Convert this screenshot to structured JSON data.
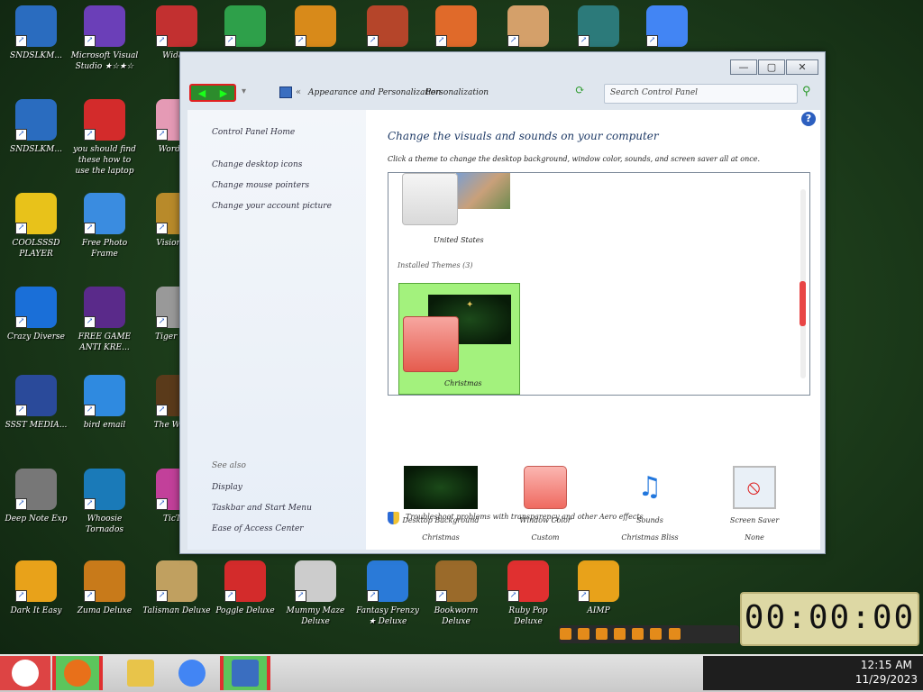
{
  "desktop_icons": [
    {
      "label": "SNDSLKM...",
      "color": "#2a6cbf"
    },
    {
      "label": "Microsoft Visual Studio ★☆★☆",
      "color": "#6b3fb8"
    },
    {
      "label": "Wida...",
      "color": "#c23030"
    },
    {
      "label": "",
      "color": "#2ea04a"
    },
    {
      "label": "",
      "color": "#d88a1a"
    },
    {
      "label": "",
      "color": "#b5452a"
    },
    {
      "label": "",
      "color": "#e06a2a"
    },
    {
      "label": "",
      "color": "#d4a06a"
    },
    {
      "label": "",
      "color": "#2c7a7a"
    },
    {
      "label": "",
      "color": "#4285f4"
    },
    {
      "label": "SNDSLKM...",
      "color": "#2a6cbf"
    },
    {
      "label": "you should find these how to use the laptop",
      "color": "#d32b2b"
    },
    {
      "label": "Word F...",
      "color": "#e59ab5"
    },
    {
      "label": "COOLSSSD PLAYER",
      "color": "#e8c21a"
    },
    {
      "label": "Free Photo Frame",
      "color": "#3a8ce0"
    },
    {
      "label": "Vision S...",
      "color": "#b88a2a"
    },
    {
      "label": "Crazy Diverse",
      "color": "#1a6fd8"
    },
    {
      "label": "FREE GAME ANTI KRE...",
      "color": "#5a2a8a"
    },
    {
      "label": "Tiger Sh...",
      "color": "#999999"
    },
    {
      "label": "SSST MEDIA...",
      "color": "#2a4a9a"
    },
    {
      "label": "bird email",
      "color": "#2f8ae0"
    },
    {
      "label": "The Wiza...",
      "color": "#5a3a1a"
    },
    {
      "label": "Deep Note Exp",
      "color": "#777777"
    },
    {
      "label": "Whoosie Tornados",
      "color": "#1a7ab8"
    },
    {
      "label": "TicToe",
      "color": "#c2409a"
    },
    {
      "label": "Dark It Easy",
      "color": "#e8a21a"
    },
    {
      "label": "Zuma Deluxe",
      "color": "#c87a1a"
    },
    {
      "label": "Talisman Deluxe",
      "color": "#c0a060"
    },
    {
      "label": "Poggle Deluxe",
      "color": "#d32b2b"
    },
    {
      "label": "Mummy Maze Deluxe",
      "color": "#cccccc"
    },
    {
      "label": "Fantasy Frenzy ★ Deluxe",
      "color": "#2a7ad8"
    },
    {
      "label": "Bookworm Deluxe",
      "color": "#9a6a2a"
    },
    {
      "label": "Ruby Pop Deluxe",
      "color": "#e03030"
    },
    {
      "label": "AIMP",
      "color": "#e8a21a"
    }
  ],
  "window": {
    "minimize": "—",
    "maximize": "▢",
    "close": "✕",
    "breadcrumb": [
      "Appearance and Personalization",
      "Personalization"
    ],
    "search_placeholder": "Search Control Panel",
    "sidebar": {
      "home": "Control Panel Home",
      "links": [
        "Change desktop icons",
        "Change mouse pointers",
        "Change your account picture"
      ],
      "see_also_title": "See also",
      "see_also": [
        "Display",
        "Taskbar and Start Menu",
        "Ease of Access Center"
      ]
    },
    "heading": "Change the visuals and sounds on your computer",
    "subheading": "Click a theme to change the desktop background, window color, sounds, and screen saver all at once.",
    "themes": {
      "first_theme": "United States",
      "section": "Installed Themes (3)",
      "selected": "Christmas"
    },
    "tiles": [
      {
        "title": "Desktop Background",
        "value": "Christmas"
      },
      {
        "title": "Window Color",
        "value": "Custom"
      },
      {
        "title": "Sounds",
        "value": "Christmas Bliss"
      },
      {
        "title": "Screen Saver",
        "value": "None"
      }
    ],
    "troubleshoot": "Troubleshoot problems with transparency and other Aero effects"
  },
  "timer": "00:00:00",
  "clock": {
    "time": "12:15 AM",
    "date": "11/29/2023"
  }
}
